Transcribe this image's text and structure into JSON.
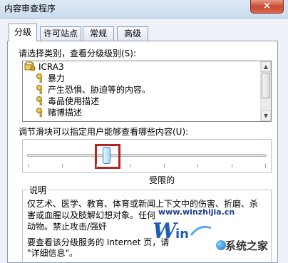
{
  "window": {
    "title": "内容审查程序",
    "close_label": "×"
  },
  "tabs": [
    {
      "label": "分级"
    },
    {
      "label": "许可站点"
    },
    {
      "label": "常规"
    },
    {
      "label": "高级"
    }
  ],
  "category_section": {
    "label": "请选择类别，查看分级级别(S):"
  },
  "categories": [
    {
      "label": "ICRA3"
    },
    {
      "label": "暴力"
    },
    {
      "label": "产生恐惧、胁迫等的内容。"
    },
    {
      "label": "毒品使用描述"
    },
    {
      "label": "赌博描述"
    }
  ],
  "slider_section": {
    "label": "调节滑块可以指定用户能够查看哪些内容(U):",
    "level_label": "受限的",
    "tick_count": 8,
    "position": 0.33
  },
  "description": {
    "title": "说明",
    "lines": [
      "仅艺术、医学、教育、体育或新闻上下文中的伤害、折磨、杀",
      "害或血腥以及肢解幻想对象。任何",
      "动物。禁止攻击/强奸"
    ],
    "footer_line1": "要查看该分级服务的 Internet 页，请",
    "footer_line2": "\"详细信息\"。"
  },
  "watermark": {
    "url": "www.winzhijia.cn",
    "site": "系统之家"
  },
  "colors": {
    "highlight": "#b32424",
    "titlebar": "#cbdcef",
    "close": "#c74a31"
  }
}
